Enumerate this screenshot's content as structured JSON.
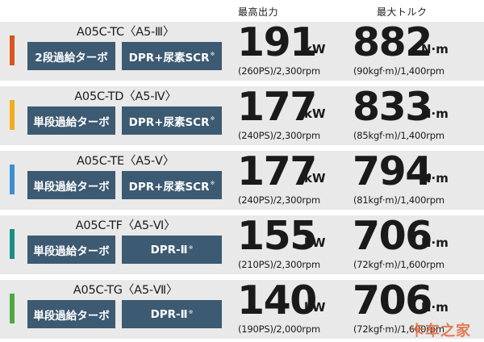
{
  "header": {
    "power_label": "最高出力",
    "torque_label": "最大トルク"
  },
  "rows": [
    {
      "model": "A05C-TC〈A5-Ⅲ〉",
      "bar_color": "#d9541e",
      "turbo_label": "2段過給ターボ",
      "after_label": "DPR+尿素SCR",
      "after_note": "※",
      "power_value": "191",
      "power_unit": "kW",
      "power_detail": "(260PS)/2,300rpm",
      "torque_value": "882",
      "torque_unit": "N·m",
      "torque_detail": "(90kgf·m)/1,400rpm"
    },
    {
      "model": "A05C-TD〈A5-Ⅳ〉",
      "bar_color": "#efad1f",
      "turbo_label": "単段過給ターボ",
      "after_label": "DPR+尿素SCR",
      "after_note": "※",
      "power_value": "177",
      "power_unit": "kW",
      "power_detail": "(240PS)/2,300rpm",
      "torque_value": "833",
      "torque_unit": "N·m",
      "torque_detail": "(85kgf·m)/1,400rpm"
    },
    {
      "model": "A05C-TE〈A5-Ⅴ〉",
      "bar_color": "#3f8fd0",
      "turbo_label": "単段過給ターボ",
      "after_label": "DPR+尿素SCR",
      "after_note": "※",
      "power_value": "177",
      "power_unit": "kW",
      "power_detail": "(240PS)/2,300rpm",
      "torque_value": "794",
      "torque_unit": "N·m",
      "torque_detail": "(81kgf·m)/1,400rpm"
    },
    {
      "model": "A05C-TF〈A5-Ⅵ〉",
      "bar_color": "#1e8d84",
      "turbo_label": "単段過給ターボ",
      "after_label": "DPR-Ⅱ",
      "after_note": "※",
      "power_value": "155",
      "power_unit": "kW",
      "power_detail": "(210PS)/2,300rpm",
      "torque_value": "706",
      "torque_unit": "N·m",
      "torque_detail": "(72kgf·m)/1,600rpm"
    },
    {
      "model": "A05C-TG〈A5-Ⅶ〉",
      "bar_color": "#4fa845",
      "turbo_label": "単段過給ターボ",
      "after_label": "DPR-Ⅱ",
      "after_note": "※",
      "power_value": "140",
      "power_unit": "kW",
      "power_detail": "(190PS)/2,000rpm",
      "torque_value": "706",
      "torque_unit": "N·m",
      "torque_detail": "(72kgf·m)/1,600rpm"
    }
  ],
  "watermark": "卡车之家"
}
